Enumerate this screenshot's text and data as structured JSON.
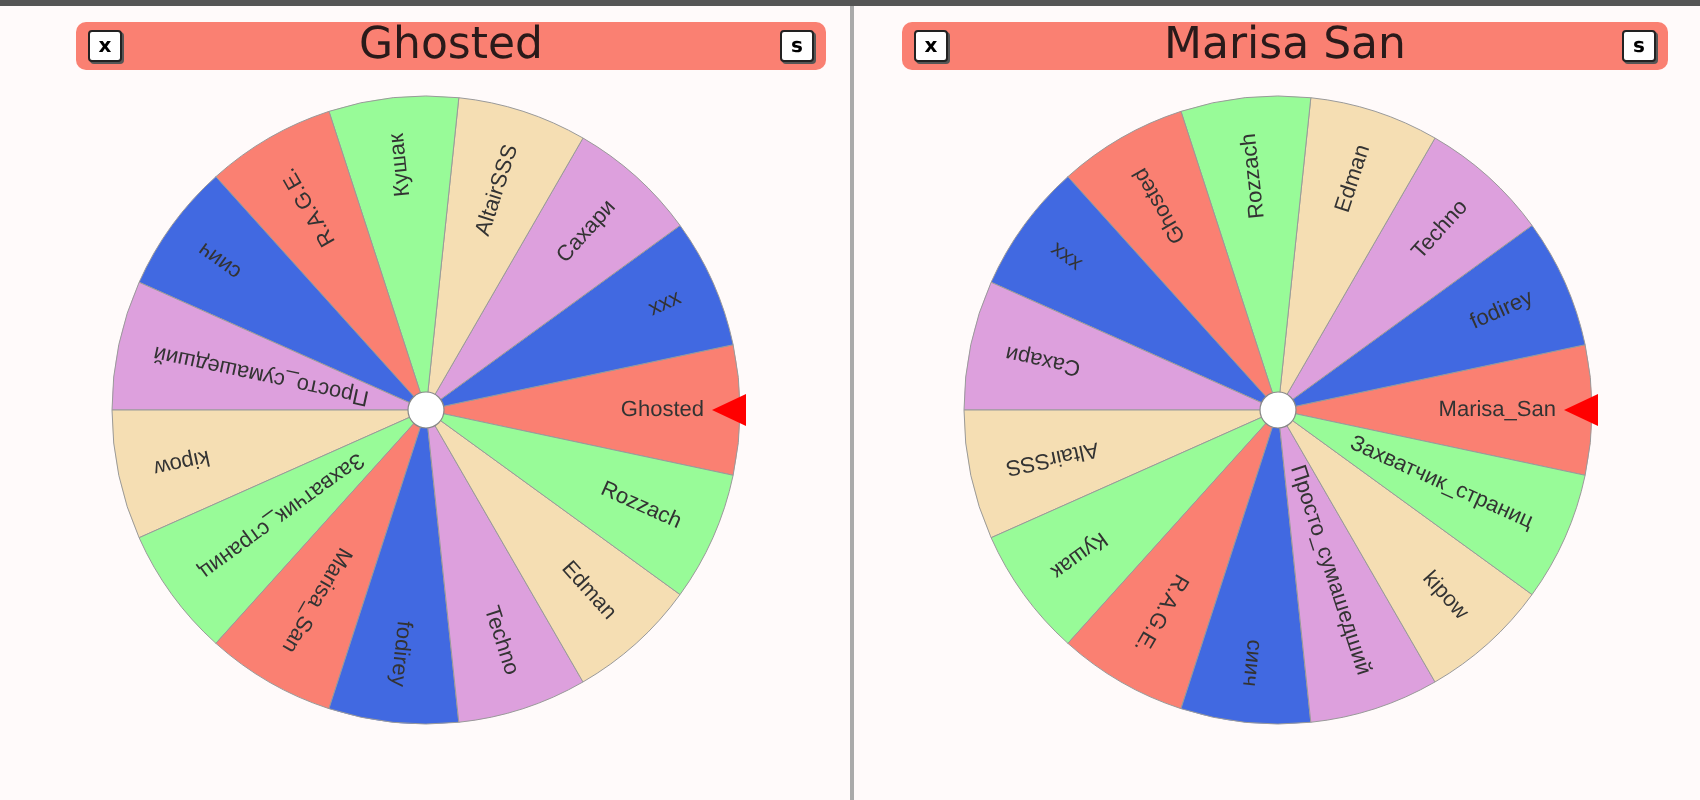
{
  "panels": [
    {
      "title": "Ghosted",
      "left_button": "x",
      "right_button": "s",
      "wheel": {
        "segments": [
          {
            "label": "Ghosted",
            "color": "#fa8072"
          },
          {
            "label": "xxx",
            "color": "#4169e1"
          },
          {
            "label": "Сахари",
            "color": "#dda0dd"
          },
          {
            "label": "AltairSSS",
            "color": "#f5deb3"
          },
          {
            "label": "Кушак",
            "color": "#98fb98"
          },
          {
            "label": "R.A.G.E.",
            "color": "#fa8072"
          },
          {
            "label": "сиич",
            "color": "#4169e1"
          },
          {
            "label": "Просто_сумашедший",
            "color": "#dda0dd"
          },
          {
            "label": "kipow",
            "color": "#f5deb3"
          },
          {
            "label": "Захватчик_страниц",
            "color": "#98fb98"
          },
          {
            "label": "Marisa_San",
            "color": "#fa8072"
          },
          {
            "label": "fodirey",
            "color": "#4169e1"
          },
          {
            "label": "Techno",
            "color": "#dda0dd"
          },
          {
            "label": "Edman",
            "color": "#f5deb3"
          },
          {
            "label": "Rozzach",
            "color": "#98fb98"
          }
        ]
      }
    },
    {
      "title": "Marisa San",
      "left_button": "x",
      "right_button": "s",
      "wheel": {
        "segments": [
          {
            "label": "Marisa_San",
            "color": "#fa8072"
          },
          {
            "label": "fodirey",
            "color": "#4169e1"
          },
          {
            "label": "Techno",
            "color": "#dda0dd"
          },
          {
            "label": "Edman",
            "color": "#f5deb3"
          },
          {
            "label": "Rozzach",
            "color": "#98fb98"
          },
          {
            "label": "Ghosted",
            "color": "#fa8072"
          },
          {
            "label": "xxx",
            "color": "#4169e1"
          },
          {
            "label": "Сахари",
            "color": "#dda0dd"
          },
          {
            "label": "AltairSSS",
            "color": "#f5deb3"
          },
          {
            "label": "Кушак",
            "color": "#98fb98"
          },
          {
            "label": "R.A.G.E.",
            "color": "#fa8072"
          },
          {
            "label": "сиич",
            "color": "#4169e1"
          },
          {
            "label": "Просто_сумашедший",
            "color": "#dda0dd"
          },
          {
            "label": "kipow",
            "color": "#f5deb3"
          },
          {
            "label": "Захватчик_страниц",
            "color": "#98fb98"
          }
        ]
      }
    }
  ]
}
